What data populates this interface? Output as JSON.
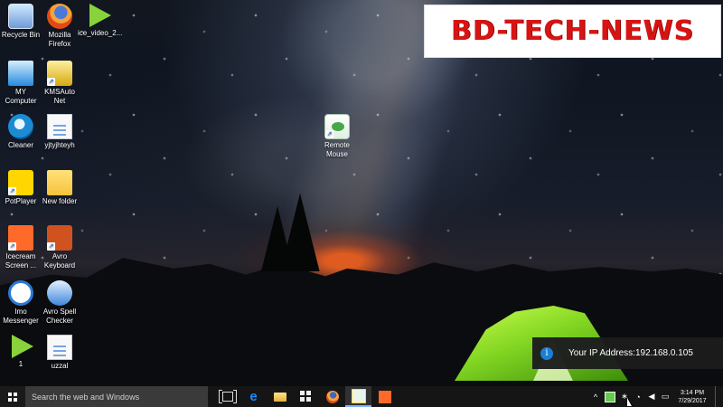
{
  "watermark": {
    "text": "BD-TECH-NEWS"
  },
  "desktop": {
    "icons": [
      {
        "label": "Recycle Bin",
        "icon": "recycle-bin-icon"
      },
      {
        "label": "Mozilla Firefox",
        "icon": "firefox-icon"
      },
      {
        "label": "ice_video_2...",
        "icon": "video-icon"
      },
      {
        "label": "MY Computer",
        "icon": "computer-icon"
      },
      {
        "label": "KMSAuto Net",
        "icon": "kms-icon"
      },
      {
        "label": "Cleaner",
        "icon": "cleaner-icon"
      },
      {
        "label": "yjtyjhteyh",
        "icon": "document-icon"
      },
      {
        "label": "PotPlayer",
        "icon": "potplayer-icon"
      },
      {
        "label": "New folder",
        "icon": "folder-icon"
      },
      {
        "label": "Icecream Screen ...",
        "icon": "icecream-icon"
      },
      {
        "label": "Avro Keyboard",
        "icon": "avro-keyboard-icon"
      },
      {
        "label": "Imo Messenger",
        "icon": "imo-icon"
      },
      {
        "label": "Avro Spell Checker",
        "icon": "spell-checker-icon"
      },
      {
        "label": "1",
        "icon": "video-icon"
      },
      {
        "label": "uzzal",
        "icon": "document-icon"
      },
      {
        "label": "Remote Mouse",
        "icon": "remote-mouse-icon"
      }
    ]
  },
  "notification": {
    "text": "Your IP Address:192.168.0.105",
    "icon": "info-icon"
  },
  "taskbar": {
    "search_placeholder": "Search the web and Windows",
    "start_icon": "windows-icon",
    "pinned_icons": [
      "task-view-icon",
      "edge-icon",
      "file-explorer-icon",
      "store-icon",
      "firefox-icon",
      "remote-mouse-icon",
      "icecream-icon"
    ],
    "tray": {
      "up_arrow": "^",
      "time": "3:14 PM",
      "date": "7/29/2017"
    }
  },
  "colors": {
    "watermark_text": "#d71414",
    "taskbar": "#151515",
    "search_box": "#3a3a3a",
    "notification": "#1c1c1d",
    "tent_green": "#82d622"
  }
}
